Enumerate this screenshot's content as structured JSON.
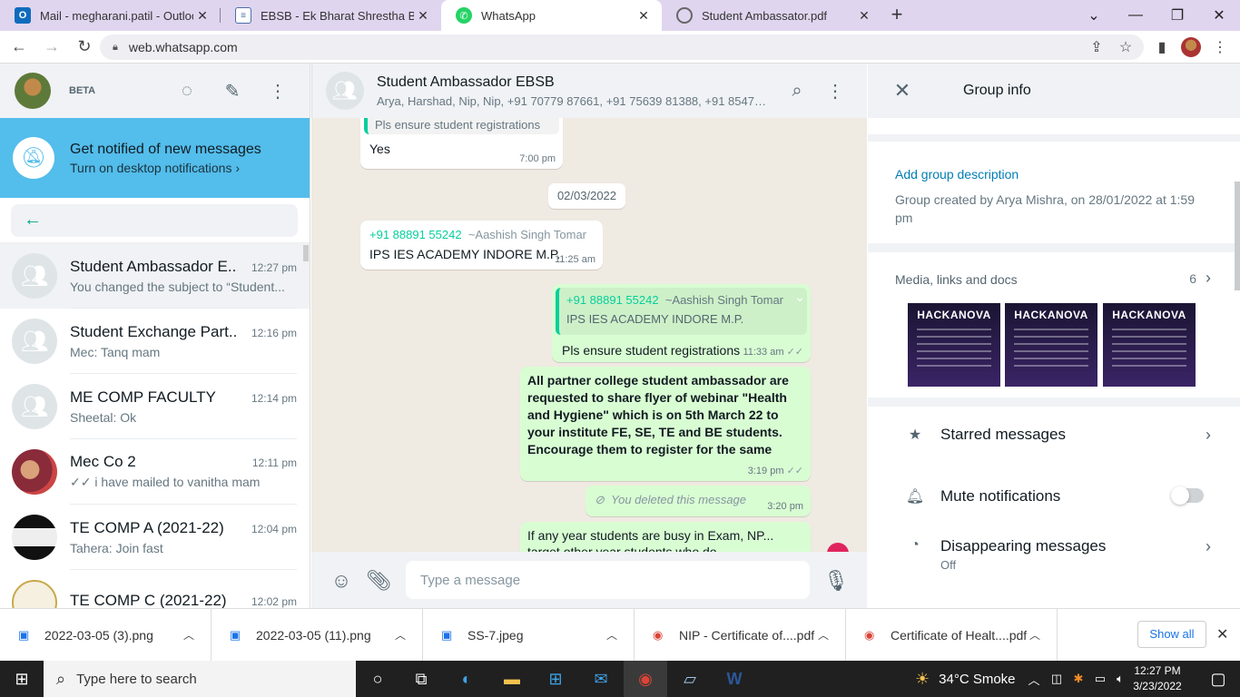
{
  "browser": {
    "tabs": [
      {
        "title": "Mail - megharani.patil - Outlook",
        "icon": "outlook-icon",
        "color": "#0f6cbd"
      },
      {
        "title": "EBSB - Ek Bharat Shrestha Bharat",
        "icon": "doc-icon",
        "color": "#4a6fa5"
      },
      {
        "title": "WhatsApp",
        "icon": "whatsapp-icon",
        "color": "#25d366"
      },
      {
        "title": "Student Ambassator.pdf",
        "icon": "globe-icon",
        "color": "#666"
      }
    ],
    "active_tab": 2,
    "url": "web.whatsapp.com"
  },
  "sidebar": {
    "badge": "BETA",
    "notification": {
      "title": "Get notified of new messages",
      "subtitle": "Turn on desktop notifications ›"
    },
    "chats": [
      {
        "name": "Student Ambassador E...",
        "time": "12:27 pm",
        "last": "You changed the subject to “Student...",
        "selected": true
      },
      {
        "name": "Student Exchange Part...",
        "time": "12:16 pm",
        "last": "Mec: Tanq mam"
      },
      {
        "name": "ME COMP FACULTY",
        "time": "12:14 pm",
        "last": "Sheetal: Ok"
      },
      {
        "name": "Mec Co 2",
        "time": "12:11 pm",
        "last": "✓✓ i have mailed to vanitha mam"
      },
      {
        "name": "TE COMP A (2021-22)",
        "time": "12:04 pm",
        "last": "Tahera: Join fast"
      },
      {
        "name": "TE COMP C (2021-22)",
        "time": "12:02 pm",
        "last": ""
      }
    ]
  },
  "conversation": {
    "title": "Student Ambassador EBSB",
    "participants": "Arya, Harshad, Nip, Nip, +91 70779 87661, +91 75639 81388, +91 85479...",
    "messages": {
      "m1_quote": "Pls ensure student registrations",
      "m1_text": "Yes",
      "m1_time": "7:00 pm",
      "date": "02/03/2022",
      "m2_sender": "+91 88891 55242",
      "m2_alias": "~Aashish Singh Tomar",
      "m2_text": "IPS IES ACADEMY INDORE M.P.",
      "m2_time": "11:25 am",
      "m3_quote_sender": "+91 88891 55242",
      "m3_quote_alias": "~Aashish Singh Tomar",
      "m3_quote_text": "IPS IES ACADEMY INDORE M.P.",
      "m3_text": "Pls ensure student registrations",
      "m3_time": "11:33 am",
      "m4_text": "All partner college student ambassador are requested to share flyer of webinar \"Health and Hygiene\" which is on 5th March 22 to your institute FE, SE, TE and BE students. Encourage them to register for the same",
      "m4_time": "3:19 pm",
      "m5_text": "You deleted this message",
      "m5_time": "3:20 pm",
      "m6_text": "If any year students are busy in Exam, NP... target other year students who do"
    },
    "input_placeholder": "Type a message"
  },
  "group_info": {
    "title": "Group info",
    "add_description": "Add group description",
    "created": "Group created by Arya Mishra, on 28/01/2022 at 1:59 pm",
    "media_label": "Media, links and docs",
    "media_count": "6",
    "media_thumb_title": "HACKANOVA",
    "starred": "Starred messages",
    "mute": "Mute notifications",
    "disappearing": "Disappearing messages",
    "disappearing_value": "Off"
  },
  "downloads": {
    "items": [
      "2022-03-05 (3).png",
      "2022-03-05 (11).png",
      "SS-7.jpeg",
      "NIP - Certificate of....pdf",
      "Certificate of Healt....pdf"
    ],
    "show_all": "Show all"
  },
  "taskbar": {
    "search_placeholder": "Type here to search",
    "weather": "34°C  Smoke",
    "time": "12:27 PM",
    "date": "3/23/2022"
  },
  "colors": {
    "accent": "#00a884",
    "notif_banner": "#53bdeb",
    "outgoing_bubble": "#d9fdd3",
    "tab_strip": "#e0d5ef"
  }
}
